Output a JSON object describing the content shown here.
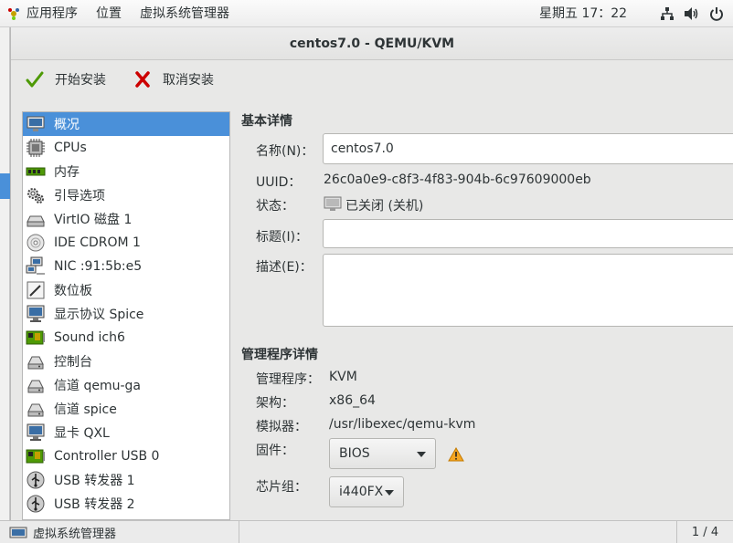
{
  "topbar": {
    "apps": "应用程序",
    "places": "位置",
    "active_app": "虚拟系统管理器",
    "clock": "星期五 17：22"
  },
  "window": {
    "title": "centos7.0 - QEMU/KVM",
    "toolbar": {
      "begin_install": "开始安装",
      "cancel_install": "取消安装"
    }
  },
  "devices": [
    {
      "label": "概况",
      "icon": "overview-monitor-icon",
      "selected": true
    },
    {
      "label": "CPUs",
      "icon": "cpu-icon"
    },
    {
      "label": "内存",
      "icon": "memory-icon"
    },
    {
      "label": "引导选项",
      "icon": "boot-gears-icon"
    },
    {
      "label": "VirtIO 磁盘 1",
      "icon": "disk-icon"
    },
    {
      "label": "IDE CDROM 1",
      "icon": "cdrom-icon"
    },
    {
      "label": "NIC :91:5b:e5",
      "icon": "network-icon"
    },
    {
      "label": "数位板",
      "icon": "tablet-icon"
    },
    {
      "label": "显示协议 Spice",
      "icon": "display-monitor-icon"
    },
    {
      "label": "Sound ich6",
      "icon": "sound-card-icon"
    },
    {
      "label": "控制台",
      "icon": "serial-console-icon"
    },
    {
      "label": "信道 qemu-ga",
      "icon": "channel-icon"
    },
    {
      "label": "信道 spice",
      "icon": "channel-icon"
    },
    {
      "label": "显卡 QXL",
      "icon": "video-card-icon"
    },
    {
      "label": "Controller USB 0",
      "icon": "usb-controller-icon"
    },
    {
      "label": "USB 转发器 1",
      "icon": "usb-redirect-icon"
    },
    {
      "label": "USB 转发器 2",
      "icon": "usb-redirect-icon"
    }
  ],
  "basic": {
    "heading": "基本详情",
    "name_label": "名称(N)：",
    "name_value": "centos7.0",
    "uuid_label": "UUID：",
    "uuid_value": "26c0a0e9-c8f3-4f83-904b-6c97609000eb",
    "status_label": "状态：",
    "status_value": "已关闭 (关机)",
    "title_label": "标题(I)：",
    "title_value": "",
    "desc_label": "描述(E)：",
    "desc_value": ""
  },
  "hypervisor": {
    "heading": "管理程序详情",
    "hv_label": "管理程序：",
    "hv_value": "KVM",
    "arch_label": "架构：",
    "arch_value": "x86_64",
    "emu_label": "模拟器：",
    "emu_value": "/usr/libexec/qemu-kvm",
    "fw_label": "固件：",
    "fw_value": "BIOS",
    "chipset_label": "芯片组：",
    "chipset_value": "i440FX"
  },
  "taskbar": {
    "task_label": "虚拟系统管理器",
    "pager": "1 / 4"
  },
  "colors": {
    "selection": "#4a90d9",
    "warning": "#f5a623",
    "check_green": "#4e9a06",
    "cancel_red": "#cc0000"
  }
}
